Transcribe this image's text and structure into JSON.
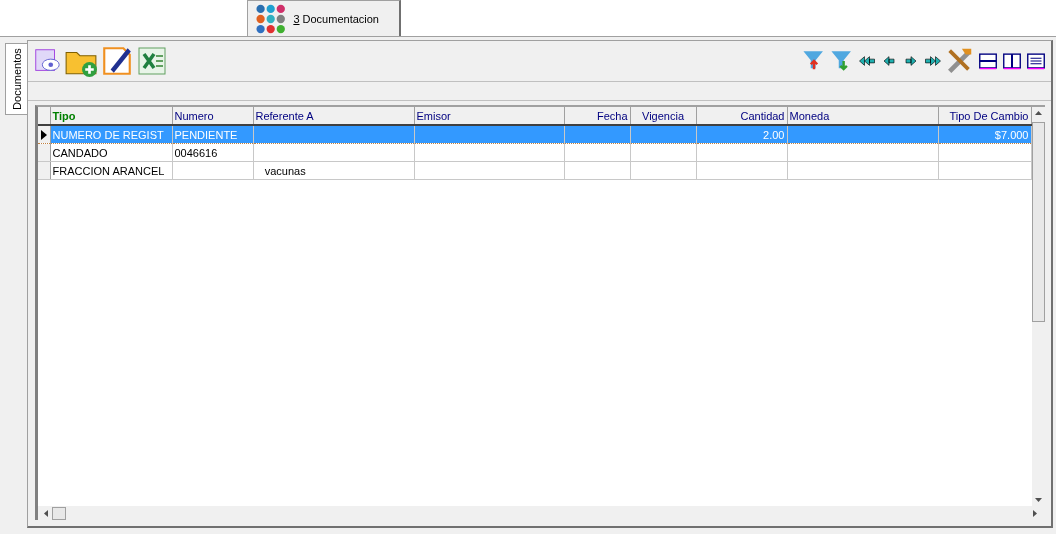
{
  "tabs": [
    {
      "label": "3 Documentacion",
      "selected": true
    }
  ],
  "side_tabs": [
    {
      "label": "Documentos",
      "selected": true
    }
  ],
  "grid": {
    "columns": [
      {
        "label": "Tipo",
        "key_column": true
      },
      {
        "label": "Numero",
        "key_column": false
      },
      {
        "label": "Referente A",
        "key_column": false
      },
      {
        "label": "Emisor",
        "key_column": false
      },
      {
        "label": "Fecha",
        "key_column": false
      },
      {
        "label": "Vigencia",
        "key_column": false
      },
      {
        "label": "Cantidad",
        "key_column": false
      },
      {
        "label": "Moneda",
        "key_column": false
      },
      {
        "label": "Tipo De Cambio",
        "key_column": false
      }
    ],
    "rows": [
      {
        "selected": true,
        "cells": [
          "NUMERO DE REGIST",
          "PENDIENTE",
          "",
          "",
          "",
          "",
          "2.00",
          "",
          "$7.000"
        ]
      },
      {
        "selected": false,
        "cells": [
          "CANDADO",
          "0046616",
          "",
          "",
          "",
          "",
          "",
          "",
          ""
        ]
      },
      {
        "selected": false,
        "cells": [
          "FRACCION ARANCEL",
          "",
          "   vacunas",
          "",
          "",
          "",
          "",
          "",
          ""
        ]
      }
    ]
  }
}
